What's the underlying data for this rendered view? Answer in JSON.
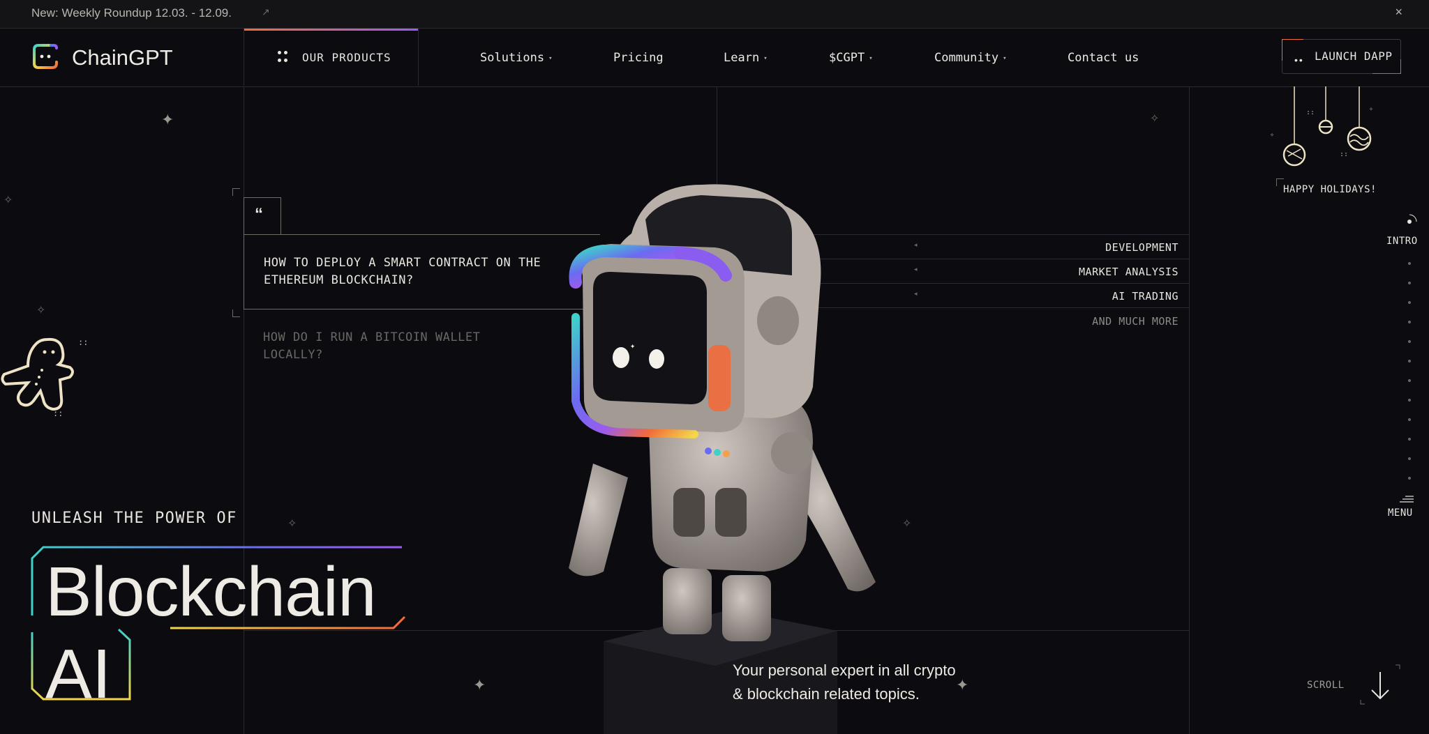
{
  "announcement": {
    "text": "New: Weekly Roundup 12.03. - 12.09.",
    "arrow": "↗",
    "close": "×"
  },
  "nav": {
    "brand": "ChainGPT",
    "products_label": "OUR PRODUCTS",
    "items": [
      {
        "label": "Solutions",
        "has_dropdown": true
      },
      {
        "label": "Pricing",
        "has_dropdown": false
      },
      {
        "label": "Learn",
        "has_dropdown": true
      },
      {
        "label": "$CGPT",
        "has_dropdown": true
      },
      {
        "label": "Community",
        "has_dropdown": true
      },
      {
        "label": "Contact us",
        "has_dropdown": false
      }
    ],
    "dropdown_caret": "▾",
    "launch_label": "LAUNCH DAPP",
    "launch_dots": "••"
  },
  "hero": {
    "eyebrow": "UNLEASH THE POWER OF",
    "title_line1": "Blockchain",
    "title_line2": "AI",
    "quote_mark": "“",
    "prompt_active": "HOW TO DEPLOY A SMART CONTRACT ON THE ETHEREUM BLOCKCHAIN?",
    "prompt_next": "HOW DO I RUN A BITCOIN WALLET LOCALLY?",
    "tags": [
      "DEVELOPMENT",
      "MARKET ANALYSIS",
      "AI TRADING"
    ],
    "tags_more": "AND MUCH MORE",
    "tag_arrow": "◂",
    "tagline_line1": "Your personal expert in all crypto",
    "tagline_line2": "& blockchain related topics."
  },
  "rail": {
    "holidays": "HAPPY HOLIDAYS!",
    "intro": "INTRO",
    "menu": "MENU",
    "scroll": "SCROLL"
  },
  "colors": {
    "background": "#0b0b10",
    "grid_line": "#2a2a30",
    "text": "#e9e6df",
    "accent_orange": "#f26b3a",
    "accent_purple": "#9a5cf0",
    "accent_teal": "#3fd0c9",
    "accent_yellow": "#f3d64a"
  },
  "icons": [
    "logo-icon",
    "grid-dots-icon",
    "chevron-down-icon",
    "close-icon",
    "external-arrow-icon",
    "sparkle-icon",
    "gingerbread-icon",
    "ornament-icon",
    "scroll-down-arrow-icon",
    "robot-illustration"
  ]
}
